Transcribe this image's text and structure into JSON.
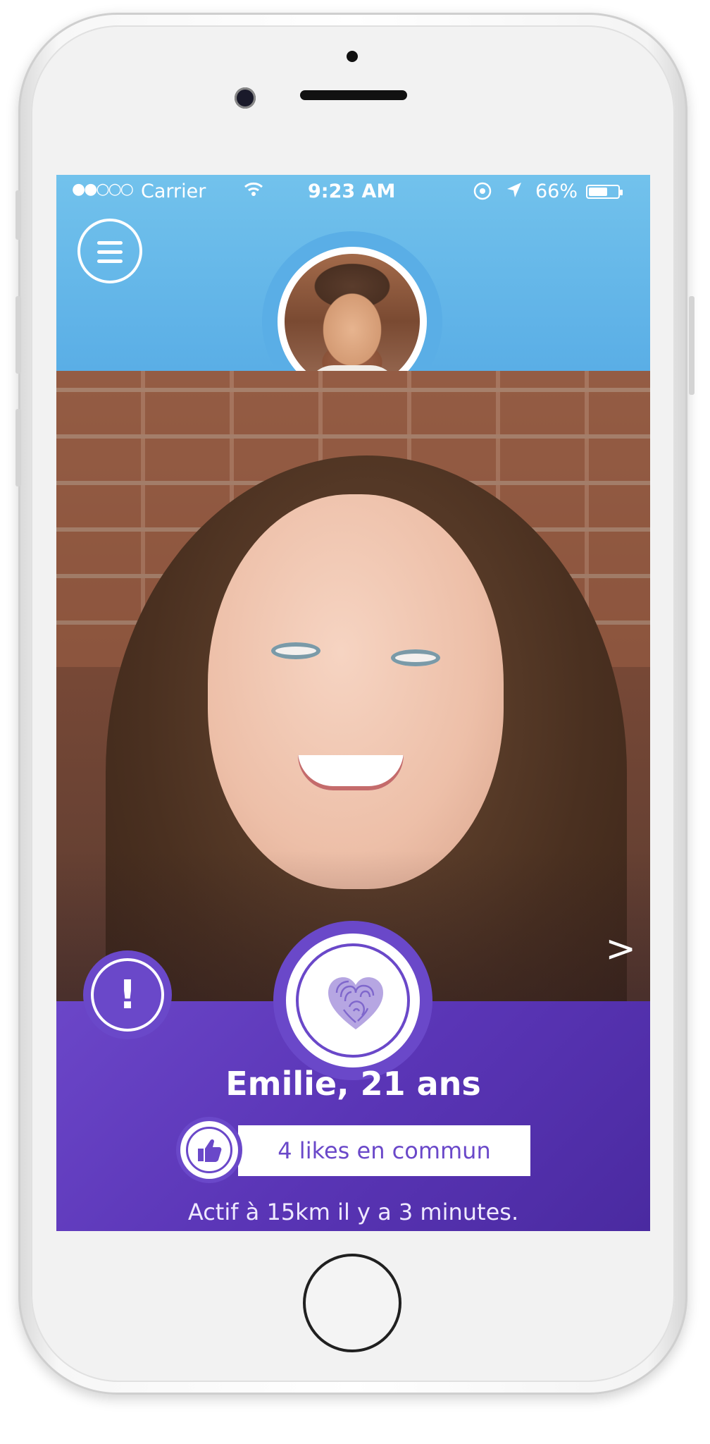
{
  "status_bar": {
    "signal": "●●○○○",
    "carrier": "Carrier",
    "time": "9:23 AM",
    "battery": "66%",
    "battery_level": 0.66
  },
  "header": {
    "menu_icon": "hamburger-menu-icon",
    "avatar_icon": "user-avatar"
  },
  "profile": {
    "name_age": "Emilie, 21 ans",
    "likes_common": "4 likes en commun",
    "activity": "Actif à 15km il y a 3 minutes.",
    "next_label": ">"
  },
  "actions": {
    "report_label": "!",
    "fingerprint_icon": "fingerprint-heart-icon",
    "like_icon": "thumbs-up-icon"
  },
  "colors": {
    "header_blue": "#5aaee6",
    "panel_purple": "#5a35b6",
    "accent_purple": "#6a48c9"
  }
}
